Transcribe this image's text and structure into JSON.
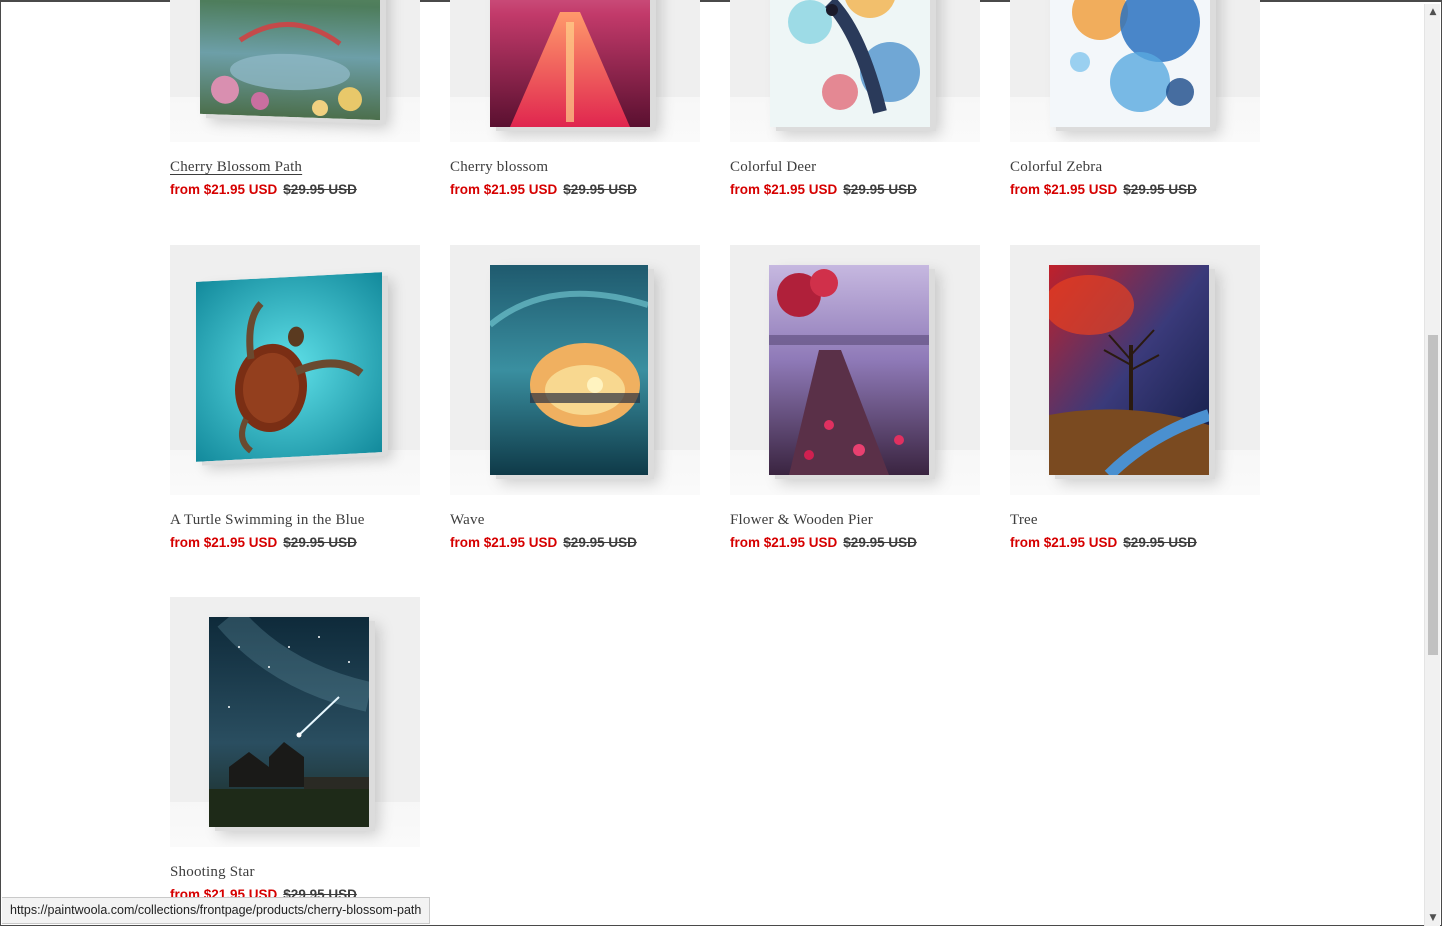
{
  "products": [
    {
      "title": "Cherry Blossom Path",
      "sale_price": "from $21.95 USD",
      "compare_price": "$29.95 USD",
      "hovered": true
    },
    {
      "title": "Cherry blossom",
      "sale_price": "from $21.95 USD",
      "compare_price": "$29.95 USD"
    },
    {
      "title": "Colorful Deer",
      "sale_price": "from $21.95 USD",
      "compare_price": "$29.95 USD"
    },
    {
      "title": "Colorful Zebra",
      "sale_price": "from $21.95 USD",
      "compare_price": "$29.95 USD"
    },
    {
      "title": "A Turtle Swimming in the Blue",
      "sale_price": "from $21.95 USD",
      "compare_price": "$29.95 USD"
    },
    {
      "title": "Wave",
      "sale_price": "from $21.95 USD",
      "compare_price": "$29.95 USD"
    },
    {
      "title": "Flower & Wooden Pier",
      "sale_price": "from $21.95 USD",
      "compare_price": "$29.95 USD"
    },
    {
      "title": "Tree",
      "sale_price": "from $21.95 USD",
      "compare_price": "$29.95 USD"
    },
    {
      "title": "Shooting Star",
      "sale_price": "from $21.95 USD",
      "compare_price": "$29.95 USD"
    }
  ],
  "status_bar": {
    "url": "https://paintwoola.com/collections/frontpage/products/cherry-blossom-path"
  },
  "colors": {
    "sale_price": "#d60000",
    "compare_price": "#3d3d3d",
    "title": "#3d3d3d"
  }
}
